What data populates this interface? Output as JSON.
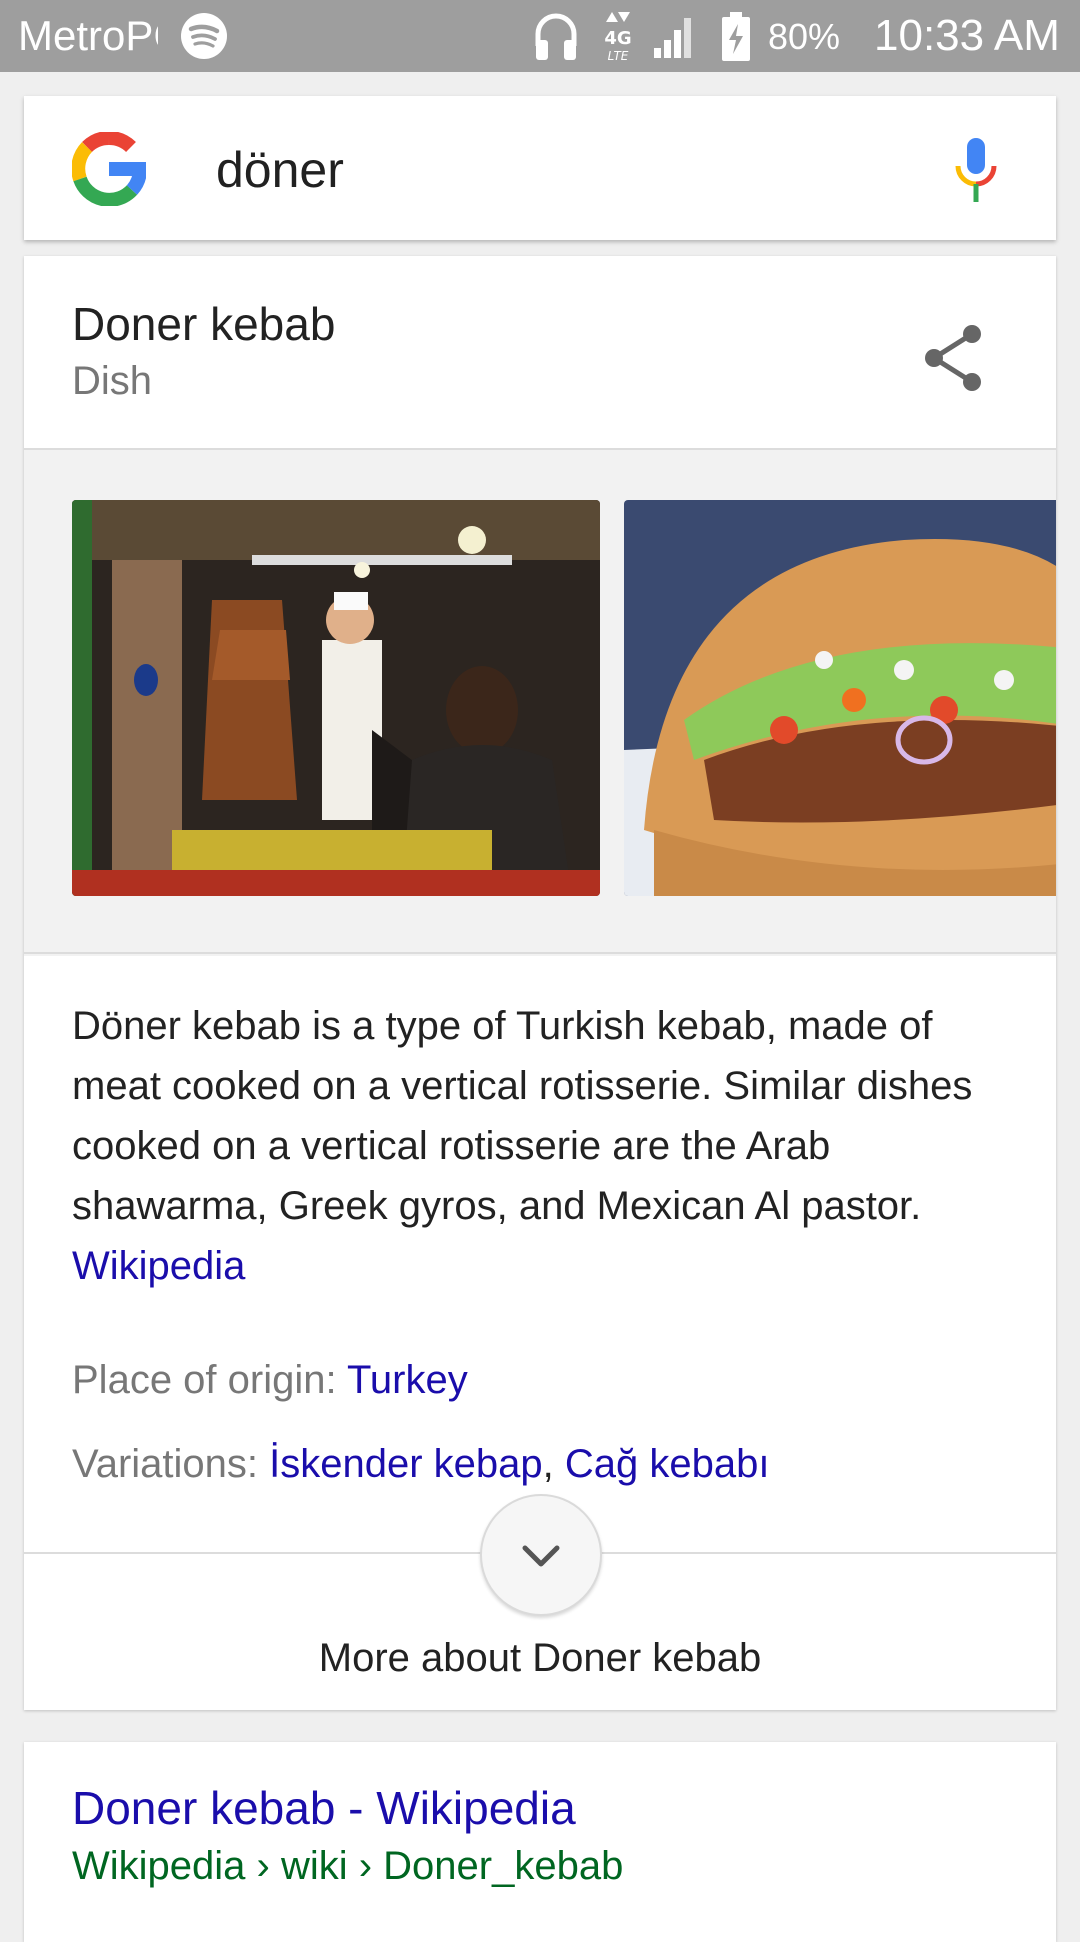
{
  "status_bar": {
    "carrier": "MetroPCS",
    "battery_percent": "80%",
    "time": "10:33 AM",
    "icons": [
      "spotify-icon",
      "headphones-icon",
      "lte-4g-icon",
      "signal-icon",
      "battery-charging-icon"
    ]
  },
  "search": {
    "query": "döner",
    "logo": "google-g-icon",
    "voice": "mic-icon"
  },
  "knowledge_panel": {
    "title": "Doner kebab",
    "subtitle": "Dish",
    "share_icon": "share-icon",
    "images": [
      "doner-rotisserie-photo",
      "doner-sandwich-photo"
    ],
    "description": "Döner kebab is a type of Turkish kebab, made of meat cooked on a vertical rotisserie. Similar dishes cooked on a vertical rotisserie are the Arab shawarma, Greek gyros, and Mexican Al pastor.",
    "source_link": "Wikipedia",
    "origin_label": "Place of origin:",
    "origin_value": "Turkey",
    "variations_label": "Variations:",
    "variations": [
      "İskender kebap",
      "Cağ kebabı"
    ],
    "variation_separator": ",",
    "more_label": "More about Doner kebab"
  },
  "result": {
    "title": "Doner kebab - Wikipedia",
    "url": "Wikipedia › wiki › Doner_kebab"
  },
  "colors": {
    "link": "#1a0dab",
    "url": "#006621",
    "status_bar": "#9e9e9e"
  }
}
